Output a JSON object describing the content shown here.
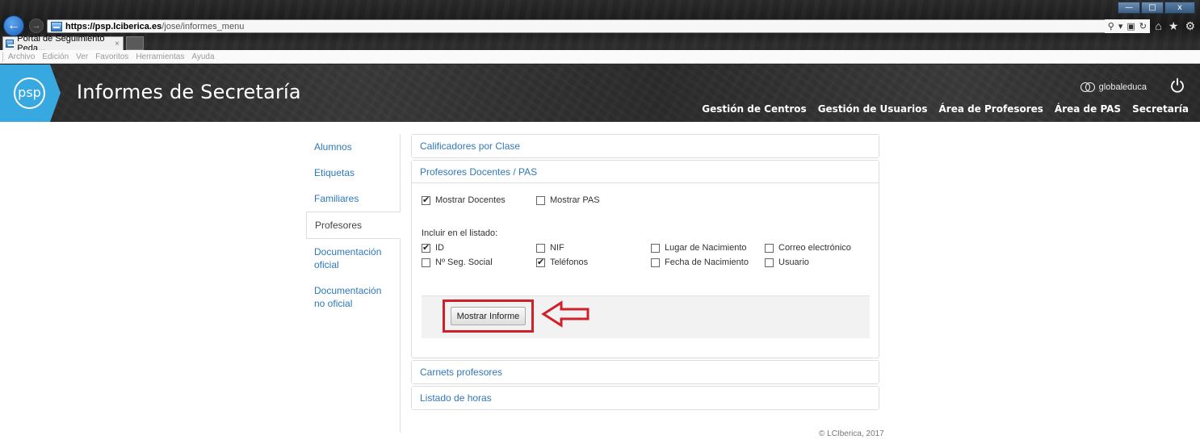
{
  "browser": {
    "url_prefix": "https://psp.",
    "url_domain": "lciberica.es",
    "url_path": "/jose/informes_menu",
    "tab_title": "Portal de Seguimiento Peda...",
    "tab_close": "×",
    "menu": [
      "Archivo",
      "Edición",
      "Ver",
      "Favoritos",
      "Herramientas",
      "Ayuda"
    ],
    "window_controls": [
      "—",
      "□",
      "x"
    ]
  },
  "header": {
    "logo_text": "psp",
    "title": "Informes de Secretaría",
    "brand": "globaleduca",
    "nav": [
      "Gestión de Centros",
      "Gestión de Usuarios",
      "Área de Profesores",
      "Área de PAS",
      "Secretaría"
    ]
  },
  "sidebar": {
    "items": [
      {
        "label": "Alumnos"
      },
      {
        "label": "Etiquetas"
      },
      {
        "label": "Familiares"
      },
      {
        "label": "Profesores"
      },
      {
        "label": "Documentación oficial"
      },
      {
        "label": "Documentación no oficial"
      }
    ]
  },
  "panels": {
    "calificadores": "Calificadores por Clase",
    "profesores": {
      "title": "Profesores Docentes / PAS",
      "show_docentes": "Mostrar Docentes",
      "show_pas": "Mostrar PAS",
      "include_label": "Incluir en el listado:",
      "fields": [
        {
          "label": "ID"
        },
        {
          "label": "NIF"
        },
        {
          "label": "Lugar de Nacimiento"
        },
        {
          "label": "Correo electrónico"
        },
        {
          "label": "Nº Seg. Social"
        },
        {
          "label": "Teléfonos"
        },
        {
          "label": "Fecha de Nacimiento"
        },
        {
          "label": "Usuario"
        }
      ],
      "button": "Mostrar Informe"
    },
    "carnets": "Carnets profesores",
    "horas": "Listado de horas"
  },
  "footer": "© LCIberica, 2017",
  "colors": {
    "link": "#2f78b8",
    "logo_blue": "#37a8e0",
    "highlight_red": "#d0202a"
  }
}
